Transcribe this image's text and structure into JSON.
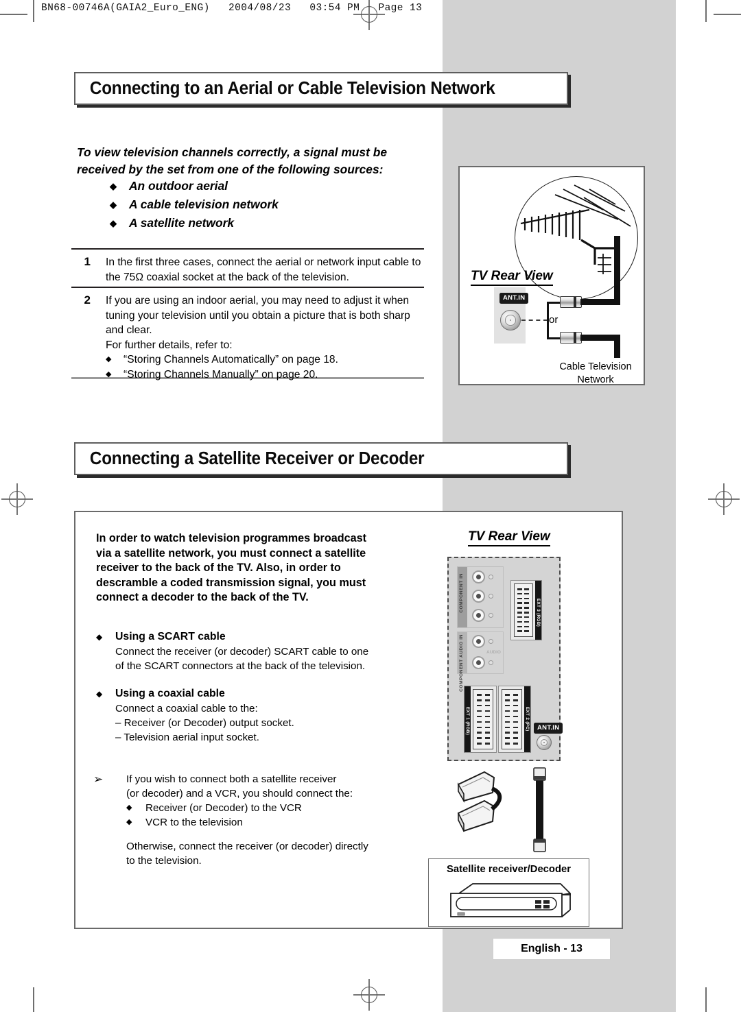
{
  "slug": "BN68-00746A(GAIA2_Euro_ENG)   2004/08/23   03:54 PM   Page 13",
  "section1": {
    "heading": "Connecting to an Aerial or Cable Television Network",
    "intro": "To view television channels correctly, a signal must be received by the set from one of the following sources:",
    "sources": [
      "An outdoor aerial",
      "A cable television network",
      "A satellite network"
    ],
    "steps": [
      {
        "num": "1",
        "text": "In the first three cases, connect the aerial or network input cable to the 75Ω coaxial socket at the back of the television."
      },
      {
        "num": "2",
        "text": "If you are using an indoor aerial, you may need to adjust it when tuning your television until you obtain a picture that is both sharp and clear.",
        "text2": "For further details, refer to:",
        "refs": [
          "“Storing Channels Automatically” on page 18.",
          "“Storing Channels Manually” on page 20."
        ]
      }
    ],
    "diagram": {
      "title": "TV Rear View",
      "port_label": "ANT.IN",
      "or_label": "or",
      "caption_line1": "Cable Television",
      "caption_line2": "Network"
    }
  },
  "section2": {
    "heading": "Connecting a Satellite Receiver or Decoder",
    "intro_bold": "In order to watch television programmes broadcast via a satellite network, you must connect a satellite receiver to the back of the TV. Also, in order to descramble a coded transmission signal, you must connect a decoder to the back of the TV.",
    "blocks": [
      {
        "title": "Using a SCART cable",
        "lines": [
          "Connect the receiver (or decoder) SCART cable to one",
          "of the SCART connectors at the back of the television."
        ]
      },
      {
        "title": "Using a coaxial cable",
        "lines": [
          "Connect a coaxial cable to the:"
        ],
        "dashes": [
          "– Receiver (or Decoder) output socket.",
          "– Television aerial input socket."
        ]
      }
    ],
    "note": {
      "arrow": "➢",
      "lines": [
        "If you wish to connect both a satellite receiver",
        "(or decoder) and a VCR, you should connect the:"
      ],
      "bullets": [
        "Receiver (or Decoder) to the VCR",
        "VCR to the television"
      ],
      "closing": [
        "Otherwise, connect the receiver (or decoder) directly",
        "to the television."
      ]
    },
    "diagram": {
      "title": "TV Rear View",
      "labels": {
        "component_in": "COMPONENT IN",
        "component_audio_in": "COMPONENT AUDIO IN",
        "audio": "AUDIO",
        "ext3": "EXT 3 (RGB)",
        "ext1": "EXT 1 (RGB)",
        "ext2": "EXT 2 (PC)",
        "ant_in": "ANT.IN"
      },
      "receiver_caption": "Satellite receiver/Decoder"
    }
  },
  "footer": "English - 13",
  "bullet_glyph": "◆",
  "colors": {
    "gray_band": "#d2d2d2",
    "panel_gray": "#d4d4d4",
    "ink": "#000000",
    "frame": "#6a6a6a"
  }
}
